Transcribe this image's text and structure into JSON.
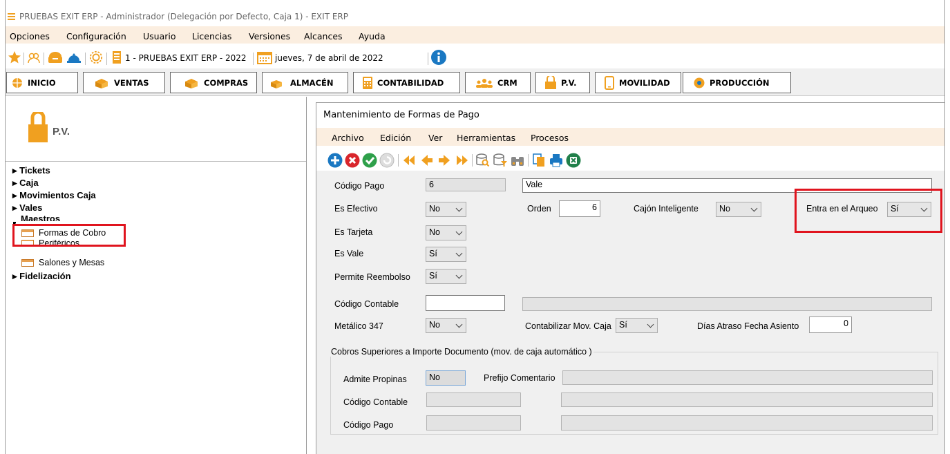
{
  "app": {
    "title": "PRUEBAS EXIT ERP - Administrador (Delegación por Defecto, Caja 1) - EXIT ERP"
  },
  "menu": [
    "Opciones",
    "Configuración",
    "Usuario",
    "Licencias",
    "Versiones",
    "Alcances",
    "Ayuda"
  ],
  "toolbar": {
    "company": "1 - PRUEBAS EXIT ERP - 2022",
    "date": "jueves, 7 de abril de 2022"
  },
  "tabs": [
    "INICIO",
    "VENTAS",
    "COMPRAS",
    "ALMACÉN",
    "CONTABILIDAD",
    "CRM",
    "P.V.",
    "MOVILIDAD",
    "PRODUCCIÓN"
  ],
  "module": {
    "label": "P.V."
  },
  "tree": {
    "tickets": "Tickets",
    "caja": "Caja",
    "movimientos": "Movimientos Caja",
    "vales": "Vales",
    "maestros": "Maestros",
    "formas": "Formas de Cobro",
    "perifericos": "Periféricos",
    "salones": "Salones y Mesas",
    "fidelizacion": "Fidelización"
  },
  "form": {
    "title": "Mantenimiento de Formas de Pago",
    "menu": [
      "Archivo",
      "Edición",
      "Ver",
      "Herramientas",
      "Procesos"
    ],
    "codigo_pago_label": "Código Pago",
    "codigo_pago": "6",
    "descripcion": "Vale",
    "es_efectivo_label": "Es Efectivo",
    "es_efectivo": "No",
    "orden_label": "Orden",
    "orden": "6",
    "cajon_label": "Cajón Inteligente",
    "cajon": "No",
    "arqueo_label": "Entra en el Arqueo",
    "arqueo": "Sí",
    "es_tarjeta_label": "Es Tarjeta",
    "es_tarjeta": "No",
    "es_vale_label": "Es Vale",
    "es_vale": "Sí",
    "reembolso_label": "Permite Reembolso",
    "reembolso": "Sí",
    "codigo_contable_label": "Código Contable",
    "codigo_contable": "",
    "metalico_label": "Metálico 347",
    "metalico": "No",
    "contabilizar_label": "Contabilizar Mov. Caja",
    "contabilizar": "Sí",
    "dias_label": "Días Atraso Fecha Asiento",
    "dias": "0",
    "group_title": "Cobros  Superiores a Importe Documento  (mov. de caja automático )",
    "propinas_label": "Admite Propinas",
    "propinas": "No",
    "prefijo_label": "Prefijo Comentario",
    "g_codigo_contable_label": "Código Contable",
    "g_codigo_pago_label": "Código Pago"
  },
  "colors": {
    "accent": "#f0a020",
    "menu_bg": "#fbeee0",
    "highlight": "#e0141e"
  }
}
